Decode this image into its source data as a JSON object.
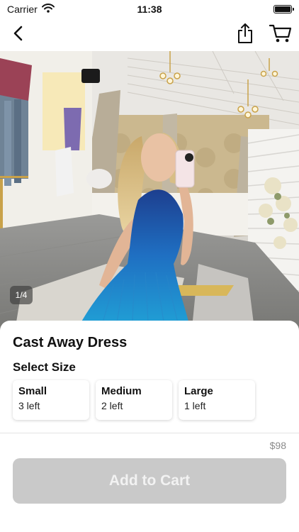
{
  "status_bar": {
    "carrier": "Carrier",
    "time": "11:38",
    "icons": [
      "wifi-icon",
      "battery-icon"
    ]
  },
  "nav": {
    "icons": [
      "back-chevron-icon",
      "share-icon",
      "cart-icon"
    ]
  },
  "gallery": {
    "page_indicator": "1/4",
    "current_page": 1,
    "total_pages": 4
  },
  "product": {
    "title": "Cast Away Dress",
    "size_heading": "Select Size",
    "sizes": [
      {
        "name": "Small",
        "stock": "3 left"
      },
      {
        "name": "Medium",
        "stock": "2 left"
      },
      {
        "name": "Large",
        "stock": "1 left"
      }
    ],
    "price": "$98"
  },
  "cta": {
    "label": "Add to Cart",
    "enabled": false
  },
  "colors": {
    "button_disabled_bg": "#c9c9c9",
    "button_disabled_text": "#f2f2f2",
    "price_text": "#8a8a8a",
    "dress_top": "#1d3f8f",
    "dress_bottom": "#21a6d8"
  }
}
